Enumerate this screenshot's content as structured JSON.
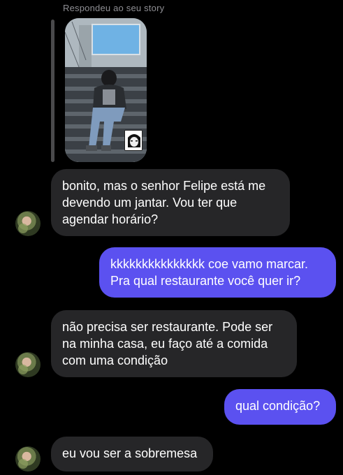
{
  "story_reply": {
    "caption": "Respondeu ao seu story"
  },
  "messages": [
    {
      "direction": "incoming",
      "text": "bonito, mas o senhor Felipe está me devendo um jantar. Vou ter que agendar horário?"
    },
    {
      "direction": "outgoing",
      "text": "kkkkkkkkkkkkkkk coe vamo marcar. Pra qual restaurante você quer ir?"
    },
    {
      "direction": "incoming",
      "text": "não precisa ser restaurante. Pode ser na minha casa, eu faço até a comida com uma condição"
    },
    {
      "direction": "outgoing",
      "text": "qual condição?"
    },
    {
      "direction": "incoming",
      "text": "eu vou ser a sobremesa"
    }
  ],
  "colors": {
    "background": "#000000",
    "incoming_bubble": "#262628",
    "outgoing_bubble": "#5b51f0",
    "caption_text": "#8e8e93"
  }
}
